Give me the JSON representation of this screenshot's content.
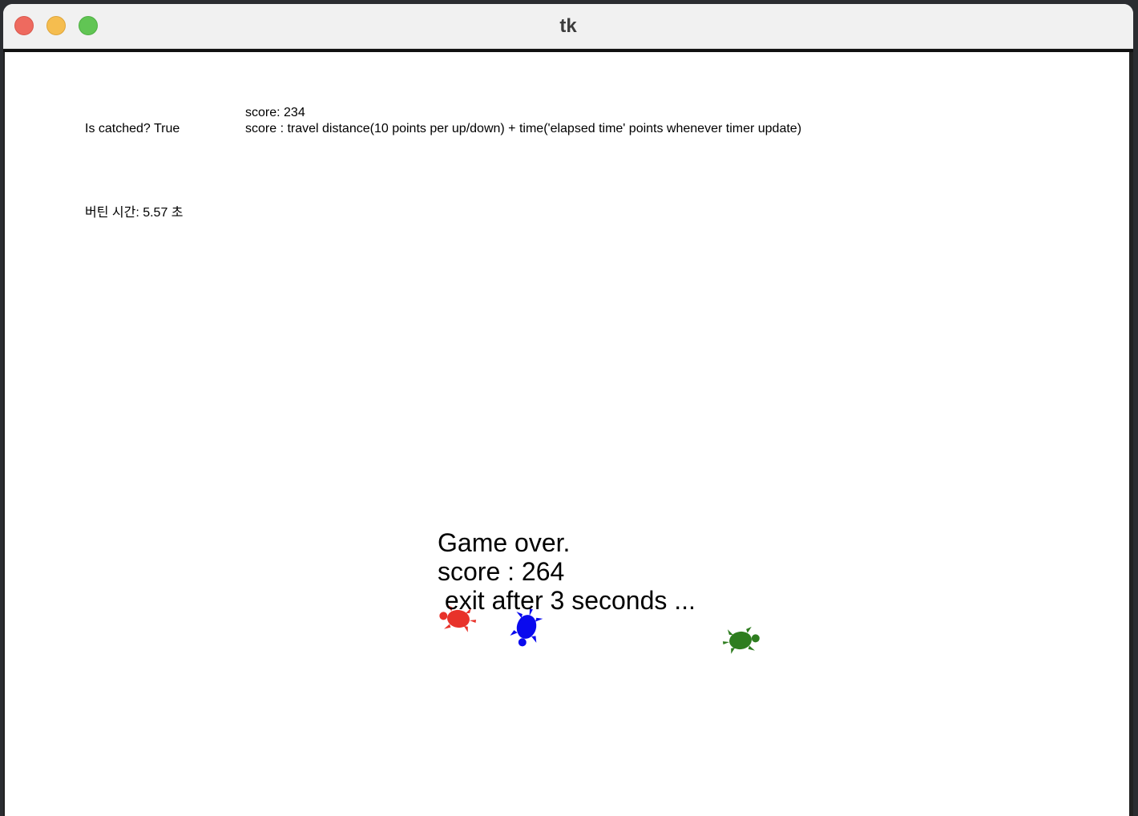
{
  "window": {
    "title": "tk"
  },
  "status": {
    "score_label": "score: 234",
    "caught_label": "Is catched? True",
    "score_rule": "score : travel distance(10 points per up/down) + time('elapsed time' points whenever timer update)",
    "survival_time": "버틴 시간: 5.57 초"
  },
  "game_over": {
    "line1": "Game over.",
    "line2": "score : 264",
    "line3": " exit after 3 seconds ..."
  },
  "turtles": [
    {
      "name": "red-turtle",
      "color": "#e8322a"
    },
    {
      "name": "blue-turtle",
      "color": "#0a0aee"
    },
    {
      "name": "green-turtle",
      "color": "#2e7d1f"
    }
  ],
  "colors": {
    "window_bg": "#ffffff",
    "titlebar_bg": "#f1f1f1",
    "close": "#ee6a5f",
    "minimize": "#f5bd4f",
    "maximize": "#61c554"
  }
}
